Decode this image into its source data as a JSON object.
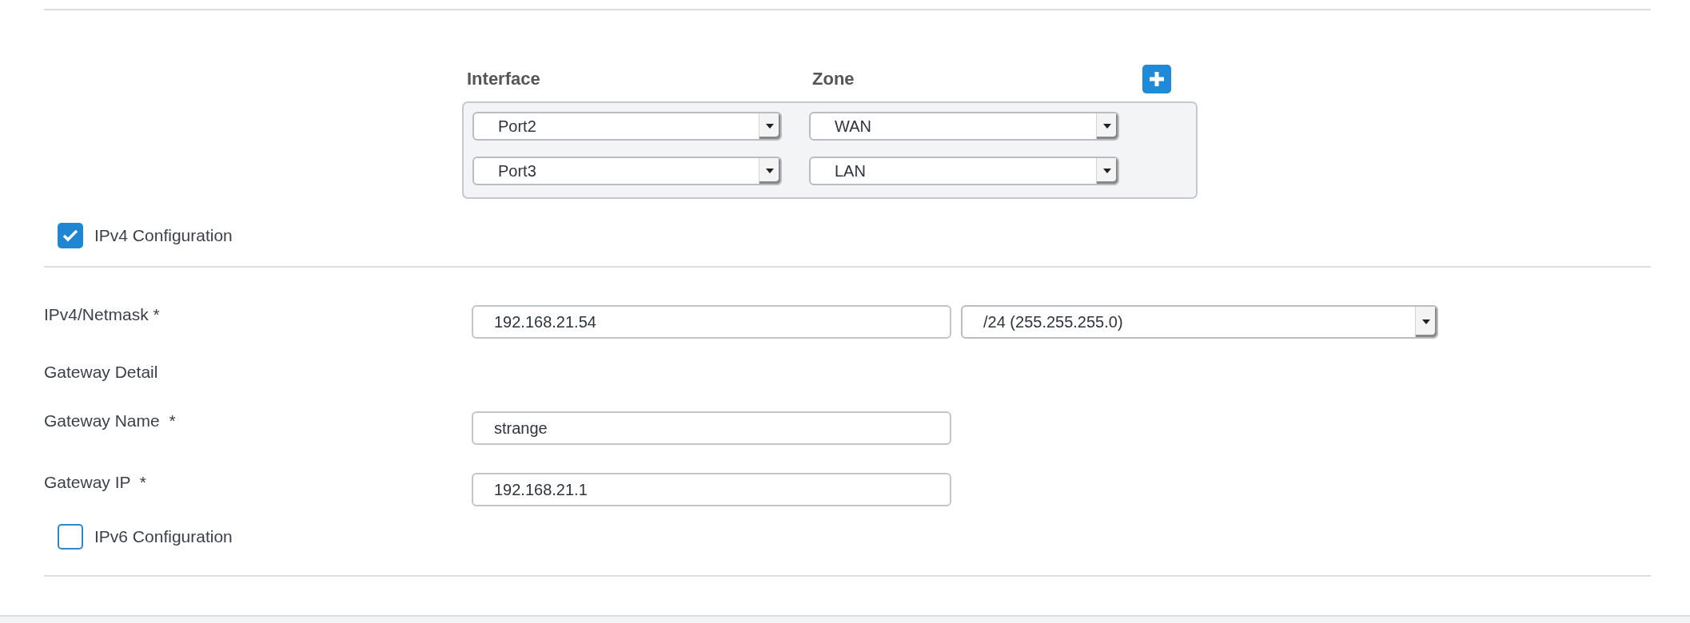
{
  "member_interfaces": {
    "columns": [
      "Interface",
      "Zone"
    ],
    "rows": [
      {
        "interface": "Port2",
        "zone": "WAN"
      },
      {
        "interface": "Port3",
        "zone": "LAN"
      }
    ]
  },
  "ipv4": {
    "label": "IPv4 Configuration",
    "checked": true
  },
  "ipv4_netmask": {
    "label": "IPv4/Netmask *",
    "address": "192.168.21.54",
    "netmask": "/24 (255.255.255.0)"
  },
  "gateway_detail": "Gateway Detail",
  "gateway_name": {
    "label": "Gateway Name  *",
    "value": "strange"
  },
  "gateway_ip": {
    "label": "Gateway IP  *",
    "value": "192.168.21.1"
  },
  "ipv6": {
    "label": "IPv6 Configuration",
    "checked": false
  }
}
